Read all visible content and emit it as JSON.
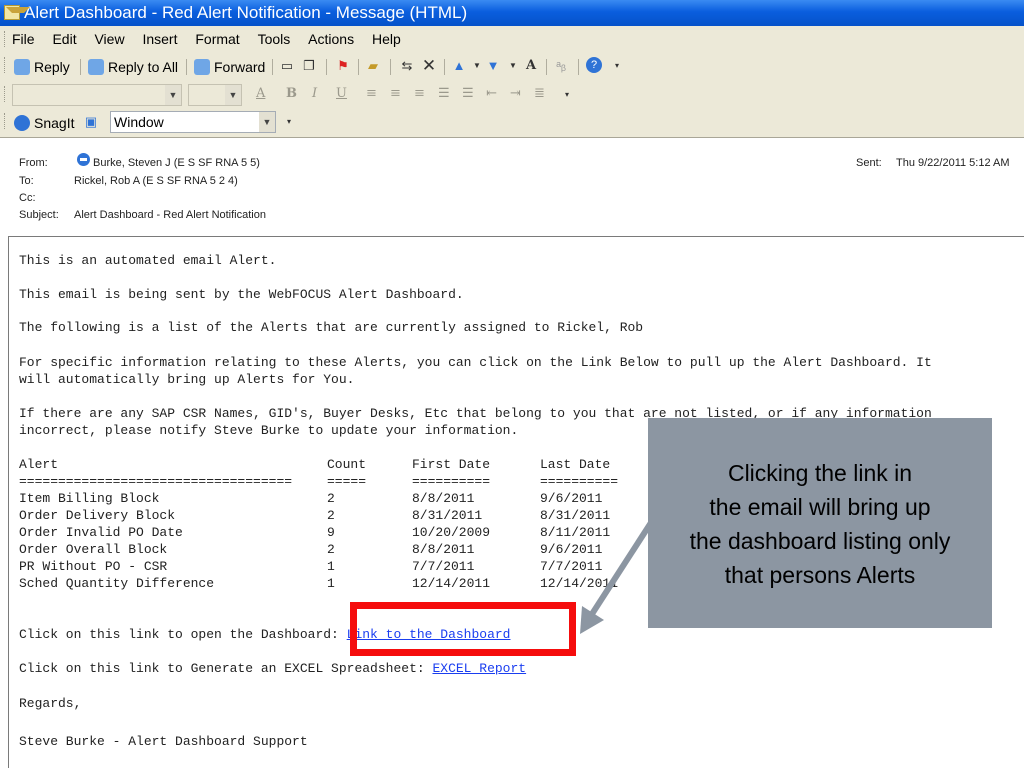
{
  "window": {
    "title": "Alert Dashboard - Red Alert Notification - Message (HTML)"
  },
  "menu": [
    "File",
    "Edit",
    "View",
    "Insert",
    "Format",
    "Tools",
    "Actions",
    "Help"
  ],
  "toolbar": {
    "reply": "Reply",
    "reply_all": "Reply to All",
    "forward": "Forward",
    "snagit": "SnagIt",
    "window_select": "Window"
  },
  "header": {
    "from_label": "From:",
    "from_value": "Burke, Steven J (E S SF RNA 5 5)",
    "to_label": "To:",
    "to_value": "Rickel, Rob A (E S SF RNA 5 2 4)",
    "cc_label": "Cc:",
    "cc_value": "",
    "subject_label": "Subject:",
    "subject_value": "Alert Dashboard - Red Alert Notification",
    "sent_label": "Sent:",
    "sent_value": "Thu 9/22/2011 5:12 AM"
  },
  "body": {
    "line1": "This is an automated email Alert.",
    "line2": "This email is being sent by the WebFOCUS Alert Dashboard.",
    "line3": "The following is a list of the Alerts that are currently assigned to Rickel, Rob",
    "line4a": "For specific information relating to these Alerts, you can click on the Link Below to pull up the Alert Dashboard. It",
    "line4b": "will automatically bring up Alerts for You.",
    "line5a": "If there are any SAP CSR Names, GID's, Buyer Desks, Etc that belong to you that are not listed, or if any information",
    "line5b": "incorrect, please notify Steve Burke to update your information.",
    "table": {
      "headers": [
        "Alert",
        "Count",
        "First Date",
        "Last Date"
      ],
      "underline": [
        "===================================",
        "=====",
        "==========",
        "=========="
      ],
      "rows": [
        [
          "Item Billing Block",
          "2",
          "8/8/2011",
          "9/6/2011"
        ],
        [
          "Order Delivery Block",
          "2",
          "8/31/2011",
          "8/31/2011"
        ],
        [
          "Order Invalid PO Date",
          "9",
          "10/20/2009",
          "8/11/2011"
        ],
        [
          "Order Overall Block",
          "2",
          "8/8/2011",
          "9/6/2011"
        ],
        [
          "PR Without PO - CSR",
          "1",
          "7/7/2011",
          "7/7/2011"
        ],
        [
          "Sched Quantity Difference",
          "1",
          "12/14/2011",
          "12/14/2011"
        ]
      ]
    },
    "dashboard_prompt": "Click on this link to open the Dashboard: ",
    "dashboard_link": "Link to the Dashboard",
    "excel_prompt": "Click on this link to Generate an EXCEL Spreadsheet: ",
    "excel_link": "EXCEL Report",
    "regards": "Regards,",
    "signature": "Steve Burke - Alert Dashboard Support"
  },
  "callout": {
    "lines": [
      "Clicking the link in",
      "the email will bring up",
      "the dashboard listing only",
      "that persons Alerts"
    ]
  },
  "colors": {
    "title_bar": "#0a5ede",
    "callout_bg": "#8c96a2",
    "highlight": "#f50d0d",
    "link": "#1a3ef0"
  }
}
